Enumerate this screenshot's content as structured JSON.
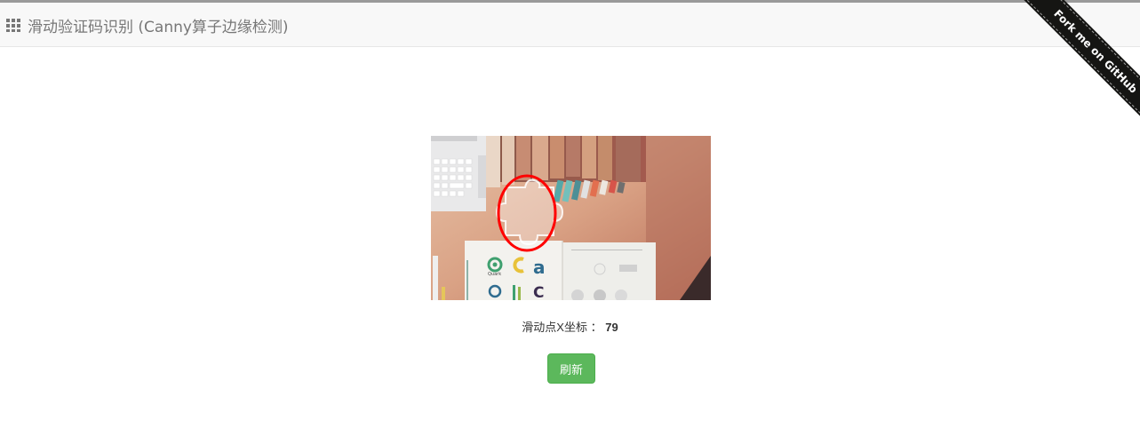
{
  "header": {
    "title": "滑动验证码识别 (Canny算子边缘检测)",
    "icon": "grid-icon"
  },
  "ribbon": {
    "label": "Fork me on GitHub"
  },
  "captcha": {
    "description_icon": "captcha-image",
    "marker_color": "#ff0000"
  },
  "result": {
    "label": "滑动点X坐标 ：",
    "value": "79"
  },
  "actions": {
    "refresh_label": "刷新",
    "refresh_color": "#5cb85c"
  }
}
